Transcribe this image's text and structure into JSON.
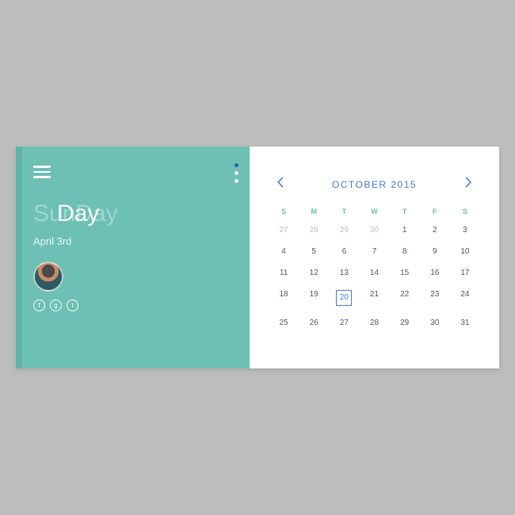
{
  "left": {
    "day_text_1": "SunDay",
    "day_text_2": "Day",
    "date_sub": "April 3rd",
    "dot_count": 3,
    "dot_active_index": 0,
    "socials": [
      "facebook",
      "google-plus",
      "twitter"
    ]
  },
  "calendar": {
    "title": "OCTOBER 2015",
    "dow": [
      "S",
      "M",
      "T",
      "W",
      "T",
      "F",
      "S"
    ],
    "rows": [
      [
        {
          "d": 27,
          "m": true
        },
        {
          "d": 28,
          "m": true
        },
        {
          "d": 29,
          "m": true
        },
        {
          "d": 30,
          "m": true
        },
        {
          "d": 1
        },
        {
          "d": 2
        },
        {
          "d": 3
        }
      ],
      [
        {
          "d": 4
        },
        {
          "d": 5
        },
        {
          "d": 6
        },
        {
          "d": 7
        },
        {
          "d": 8
        },
        {
          "d": 9
        },
        {
          "d": 10
        }
      ],
      [
        {
          "d": 11
        },
        {
          "d": 12
        },
        {
          "d": 13
        },
        {
          "d": 14
        },
        {
          "d": 15
        },
        {
          "d": 16
        },
        {
          "d": 17
        }
      ],
      [
        {
          "d": 18
        },
        {
          "d": 19
        },
        {
          "d": 20,
          "sel": true
        },
        {
          "d": 21
        },
        {
          "d": 22
        },
        {
          "d": 23
        },
        {
          "d": 24
        }
      ],
      [
        {
          "d": 25
        },
        {
          "d": 26
        },
        {
          "d": 27
        },
        {
          "d": 28
        },
        {
          "d": 29
        },
        {
          "d": 30
        },
        {
          "d": 31
        }
      ]
    ],
    "selected_day": 20
  },
  "colors": {
    "teal": "#6cc0b4",
    "blue": "#4a7dcf"
  }
}
